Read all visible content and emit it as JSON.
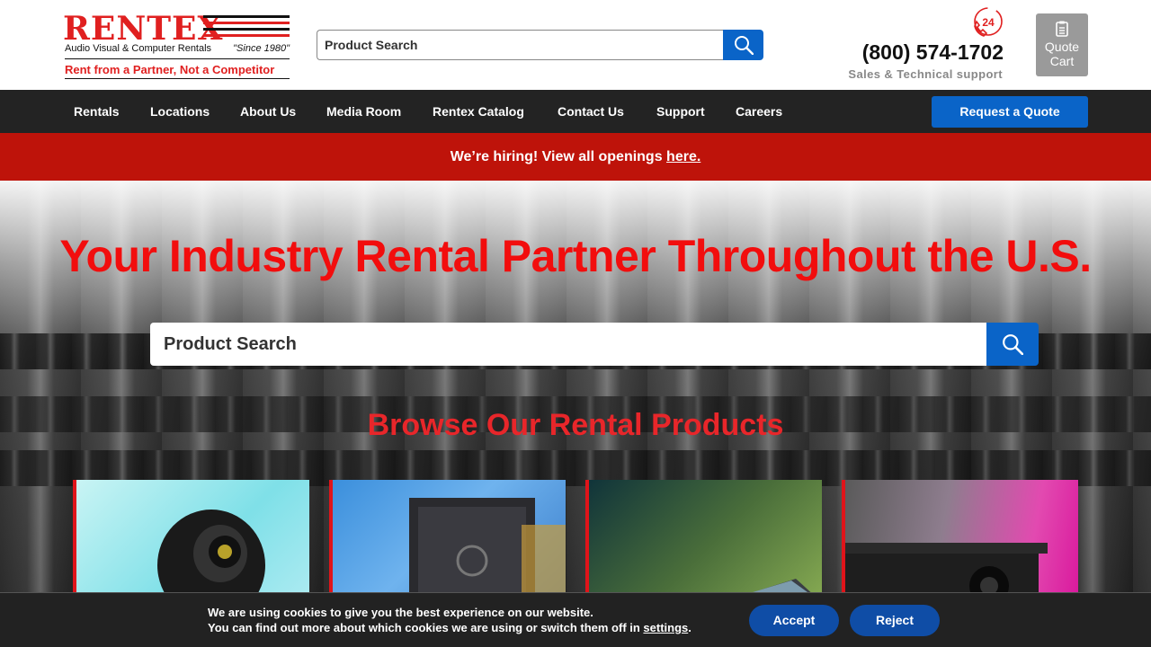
{
  "header": {
    "logo": {
      "word": "RENTEX",
      "subtitle": "Audio Visual & Computer Rentals",
      "since": "\"Since 1980\"",
      "tagline": "Rent from a Partner, Not a Competitor"
    },
    "search_placeholder": "Product Search",
    "phone": "(800) 574-1702",
    "phone_sub": "Sales & Technical support",
    "phone_icon_text": "24",
    "quote_cart_line1": "Quote",
    "quote_cart_line2": "Cart"
  },
  "nav": {
    "items": [
      {
        "label": "Rentals"
      },
      {
        "label": "Locations"
      },
      {
        "label": "About Us"
      },
      {
        "label": "Media Room"
      },
      {
        "label": "Rentex Catalog"
      },
      {
        "label": "Contact Us"
      },
      {
        "label": "Support"
      },
      {
        "label": "Careers"
      }
    ],
    "request_quote": "Request a Quote"
  },
  "banner": {
    "text": "We’re hiring! View all openings ",
    "link": "here."
  },
  "hero": {
    "title": "Your Industry Rental Partner Throughout the U.S.",
    "search_placeholder": "Product Search",
    "browse_title": "Browse Our Rental Products"
  },
  "cookie": {
    "line1": "We are using cookies to give you the best experience on our website.",
    "line2_prefix": "You can find out more about which cookies we are using or switch them off in ",
    "settings_link": "settings",
    "line2_suffix": ".",
    "accept": "Accept",
    "reject": "Reject"
  },
  "colors": {
    "brand_red": "#e02020",
    "accent_blue": "#0a64c8",
    "nav_bg": "#232323",
    "banner_red": "#be130a"
  },
  "icons": [
    "search-icon",
    "phone-24-icon",
    "clipboard-icon"
  ]
}
